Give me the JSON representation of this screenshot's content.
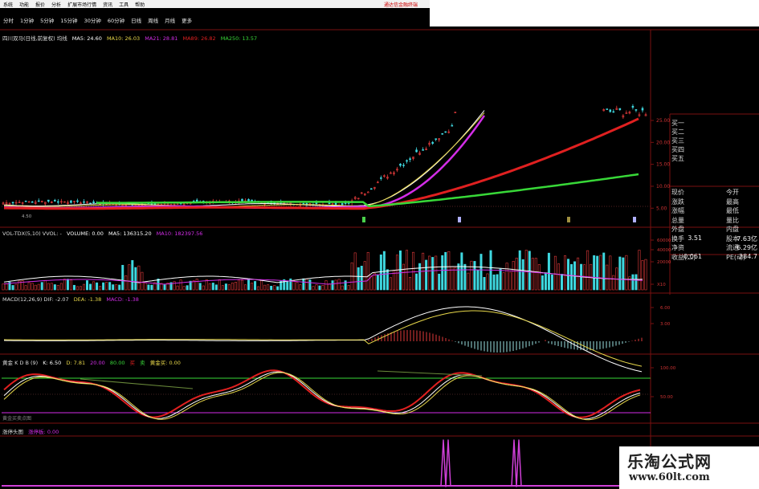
{
  "menu": {
    "items": [
      "系统",
      "功能",
      "报价",
      "分析",
      "扩展市场行情",
      "资讯",
      "工具",
      "帮助"
    ],
    "hot_label": "通达信金融终端"
  },
  "periods": [
    "分时",
    "1分钟",
    "5分钟",
    "15分钟",
    "30分钟",
    "60分钟",
    "日线",
    "周线",
    "月线",
    "更多"
  ],
  "main_panel": {
    "title": "四川双马(日线,前复权) 均线",
    "ma5": "MA5: 24.60",
    "ma10": "MA10: 26.03",
    "ma21": "MA21: 28.81",
    "ma89": "MA89: 26.82",
    "ma250": "MA250: 13.57",
    "axis": [
      "25.00",
      "20.00",
      "15.00",
      "10.00",
      "5.00"
    ],
    "low_label": "4.50"
  },
  "volume_panel": {
    "title": "VOL-TDX(5,10) VVOL: -",
    "volume": "VOLUME: 0.00",
    "ma5": "MA5: 136315.20",
    "ma10": "MA10: 182397.56",
    "axis": [
      "60000",
      "40000",
      "20000",
      "X10"
    ]
  },
  "macd_panel": {
    "title": "MACD(12,26,9) DIF: -2.07",
    "dea": "DEA: -1.38",
    "macd": "MACD: -1.38",
    "axis": [
      "6.00",
      "3.00"
    ]
  },
  "kdj_panel": {
    "title": "黄金 K D B (9)",
    "k": "K: 6.50",
    "d": "D: 7.81",
    "v1": "20.00",
    "v2": "80.00",
    "buy": "买",
    "sell": "卖",
    "gold": "黄金买: 0.00",
    "axis": [
      "100.00",
      "50.00"
    ],
    "bottom_label": "黄金买卖点图"
  },
  "signal_panel": {
    "title": "涨停头图",
    "value": "涨停板: 0.00"
  },
  "right_panel": {
    "book": [
      "买一",
      "买二",
      "买三",
      "买四",
      "买五"
    ],
    "rows": [
      [
        "现价",
        "",
        "今开",
        ""
      ],
      [
        "涨跌",
        "",
        "最高",
        ""
      ],
      [
        "涨幅",
        "",
        "最低",
        ""
      ],
      [
        "总量",
        "",
        "量比",
        ""
      ],
      [
        "外盘",
        "",
        "内盘",
        ""
      ],
      [
        "换手",
        "3.51",
        "股本",
        "7.63亿"
      ],
      [
        "净资",
        "",
        "流通",
        "6.29亿"
      ],
      [
        "收益(二)",
        "0.061",
        "PE(动)",
        "284.7"
      ]
    ]
  },
  "watermark": {
    "line1": "乐淘公式网",
    "line2": "www.60lt.com"
  },
  "colors": {
    "up": "#e03a3a",
    "down": "#3fd8e0",
    "ma_white": "#ffffff",
    "ma_yellow": "#e8d84a",
    "ma_magenta": "#d32de8",
    "ma_red": "#e02020",
    "ma_green": "#38d838",
    "grid_red": "#7a1010",
    "signal": "#d040d8"
  },
  "icons": [
    "title-bar"
  ]
}
